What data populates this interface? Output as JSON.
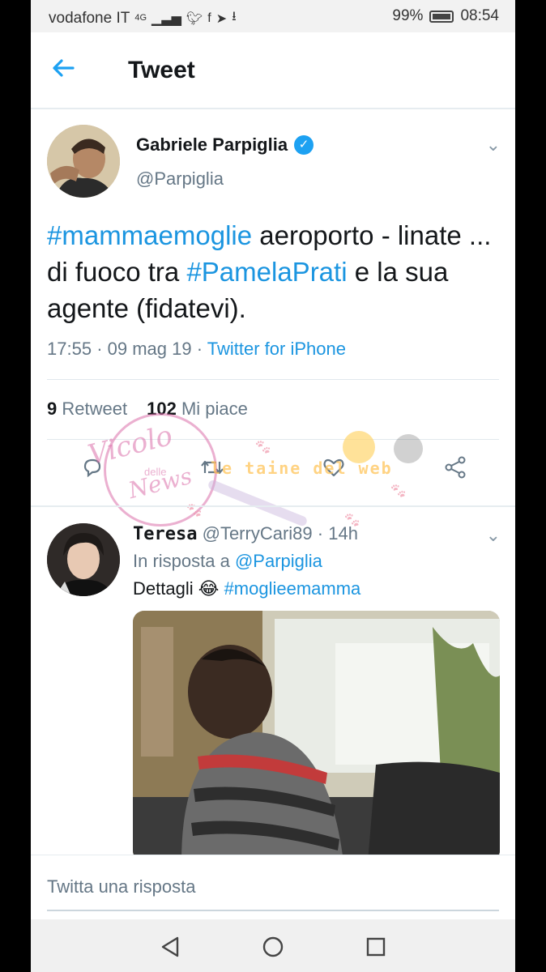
{
  "status_bar": {
    "carrier": "vodafone IT",
    "network": "4G",
    "battery": "99%",
    "time": "08:54"
  },
  "header": {
    "title": "Tweet"
  },
  "tweet": {
    "author_name": "Gabriele Parpiglia",
    "author_handle": "@Parpiglia",
    "text_parts": {
      "hashtag1": "#mammaemoglie",
      "text1": " aeroporto - linate ... di fuoco tra ",
      "hashtag2": "#PamelaPrati",
      "text2": " e la sua agente (fidatevi)."
    },
    "time": "17:55",
    "date": "09 mag 19",
    "source": "Twitter for iPhone",
    "retweets_count": "9",
    "retweets_label": "Retweet",
    "likes_count": "102",
    "likes_label": "Mi piace"
  },
  "reply": {
    "name": "Teresa",
    "handle": "@TerryCari89",
    "age": "14h",
    "reply_to_label": "In risposta a",
    "reply_to_handle": "@Parpiglia",
    "text": "Dettagli",
    "emoji": "😂",
    "hashtag": "#moglieemamma"
  },
  "compose": {
    "placeholder": "Twitta una risposta"
  },
  "watermark": {
    "left_main": "Vicolo",
    "left_small": "delle",
    "left_bottom": "News",
    "right": "le taine del web"
  },
  "colors": {
    "accent": "#1da1f2",
    "link": "#1b95e0",
    "secondary_text": "#657786"
  }
}
